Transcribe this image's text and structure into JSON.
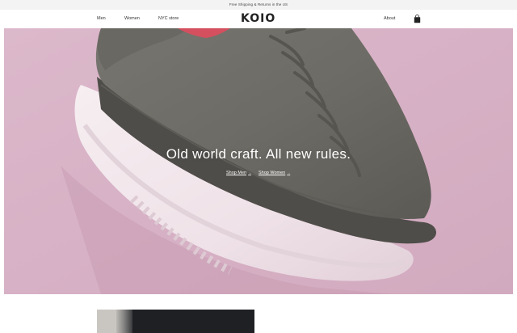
{
  "announcement": "Free Shipping & Returns in the US",
  "nav": {
    "logo": "KOIO",
    "links": [
      "Men",
      "Women",
      "NYC store"
    ],
    "about": "About",
    "cart_icon": "shopping-bag-icon"
  },
  "hero": {
    "headline": "Old world craft. All new rules.",
    "cta_men": "Shop Men",
    "cta_women": "Shop Women",
    "background_color": "#d9b3c8"
  },
  "colors": {
    "text": "#222222",
    "announcement_bg": "#f3f3f3",
    "hero_text": "#ffffff"
  }
}
